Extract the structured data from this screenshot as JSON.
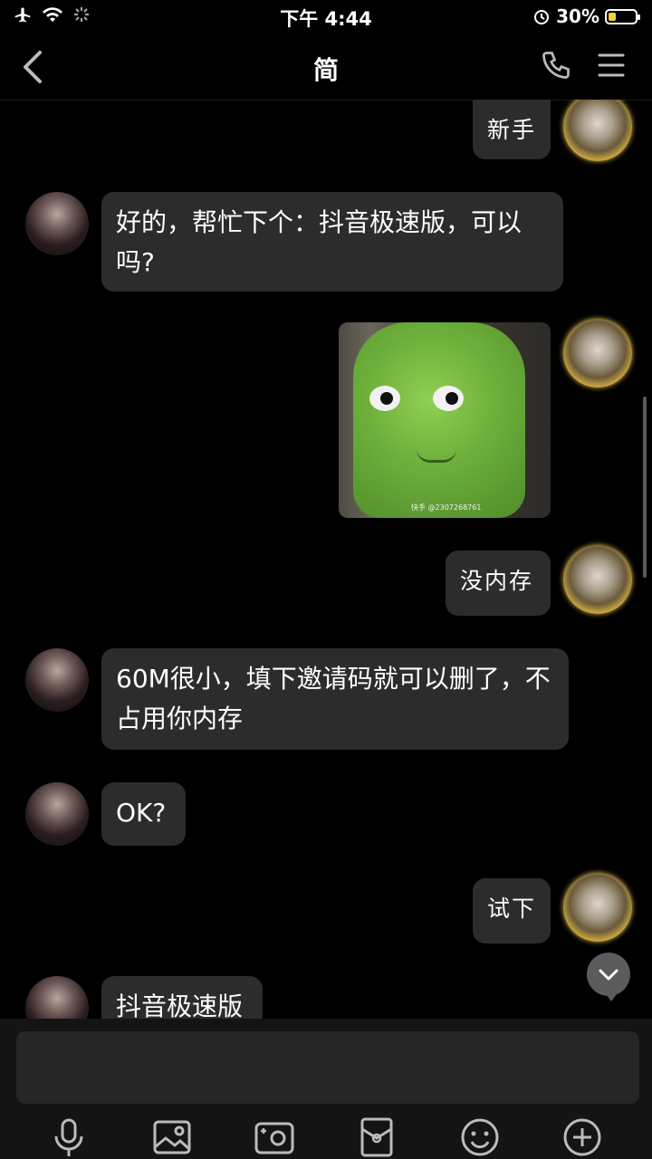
{
  "status": {
    "time": "下午 4:44",
    "battery": "30%"
  },
  "header": {
    "title": "简"
  },
  "messages": [
    {
      "side": "right",
      "text": "新手"
    },
    {
      "side": "left",
      "text": "好的，帮忙下个：抖音极速版，可以吗?"
    },
    {
      "side": "right",
      "type": "sticker",
      "watermark": "快手 @2307268761"
    },
    {
      "side": "right",
      "text": "没内存"
    },
    {
      "side": "left",
      "text": "60M很小，填下邀请码就可以删了，不占用你内存"
    },
    {
      "side": "left",
      "text": "OK?"
    },
    {
      "side": "right",
      "text": "试下"
    },
    {
      "side": "left",
      "text": "抖音极速版"
    }
  ],
  "composer": {
    "placeholder": ""
  },
  "toolbar": [
    "microphone-icon",
    "image-icon",
    "camera-icon",
    "red-packet-icon",
    "emoji-icon",
    "plus-icon"
  ]
}
